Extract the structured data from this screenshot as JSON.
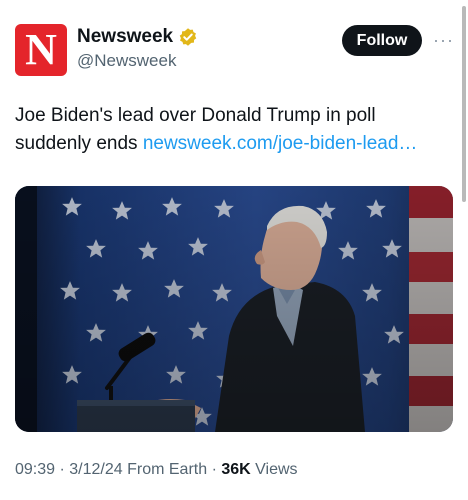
{
  "account": {
    "logo_letter": "N",
    "display_name": "Newsweek",
    "handle": "@Newsweek",
    "verified_badge": "gold-verified-badge-icon"
  },
  "actions": {
    "follow_label": "Follow",
    "more_label": "···"
  },
  "tweet": {
    "text": "Joe Biden's lead over Donald Trump in poll suddenly ends",
    "link": "newsweek.com/joe-biden-lead…"
  },
  "media": {
    "description_icon": "photo-of-speaker-in-front-of-us-flag"
  },
  "meta": {
    "time": "09:39",
    "date": "3/12/24",
    "location": "From Earth",
    "views_count": "36K",
    "views_label": "Views"
  },
  "colors": {
    "brand": "#e4252b",
    "link": "#1d9bf0",
    "verified": "#e2b719"
  }
}
